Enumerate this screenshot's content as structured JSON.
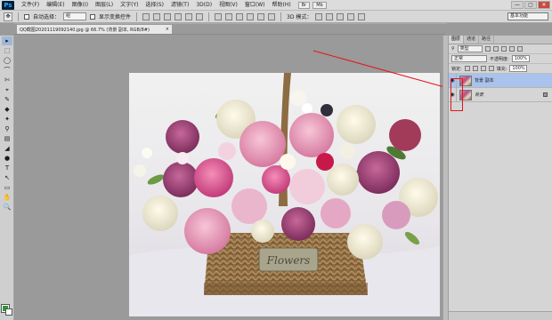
{
  "app": {
    "logo": "Ps"
  },
  "menu": [
    "文件(F)",
    "编辑(E)",
    "图像(I)",
    "图层(L)",
    "文字(Y)",
    "选择(S)",
    "滤镜(T)",
    "3D(D)",
    "视图(V)",
    "窗口(W)",
    "帮助(H)"
  ],
  "window_buttons": [
    "—",
    "▢",
    "✕"
  ],
  "options_bar": {
    "auto_select_label": "自动选择：",
    "auto_select_value": "组",
    "show_transform_label": "显示变换控件",
    "mode_label": "3D 模式：",
    "workspace": "基本功能"
  },
  "document": {
    "tab_title": "QQ截图20201119092140.jpg @ 66.7% (背景 副本, RGB/8#)",
    "close": "×"
  },
  "canvas": {
    "basket_text": "Flowers"
  },
  "tools": [
    "▸",
    "⬚",
    "◯",
    "⌒",
    "✄",
    "⌖",
    "✎",
    "◆",
    "✦",
    "⚲",
    "▤",
    "◢",
    "●",
    "T",
    "↖",
    "▭",
    "✋",
    "🔍"
  ],
  "layers_panel": {
    "tabs": [
      "图层",
      "通道",
      "路径"
    ],
    "kind": "类型",
    "blend_mode": "正常",
    "opacity_label": "不透明度:",
    "opacity": "100%",
    "lock_label": "锁定:",
    "fill_label": "填充:",
    "fill": "100%",
    "layers": [
      {
        "name": "背景 副本",
        "active": true
      },
      {
        "name": "背景",
        "active": false
      }
    ]
  },
  "colors": {
    "accent_selection": "#a9c3ec",
    "annotation_red": "#e3141b",
    "foreground": "#2a9a35"
  }
}
